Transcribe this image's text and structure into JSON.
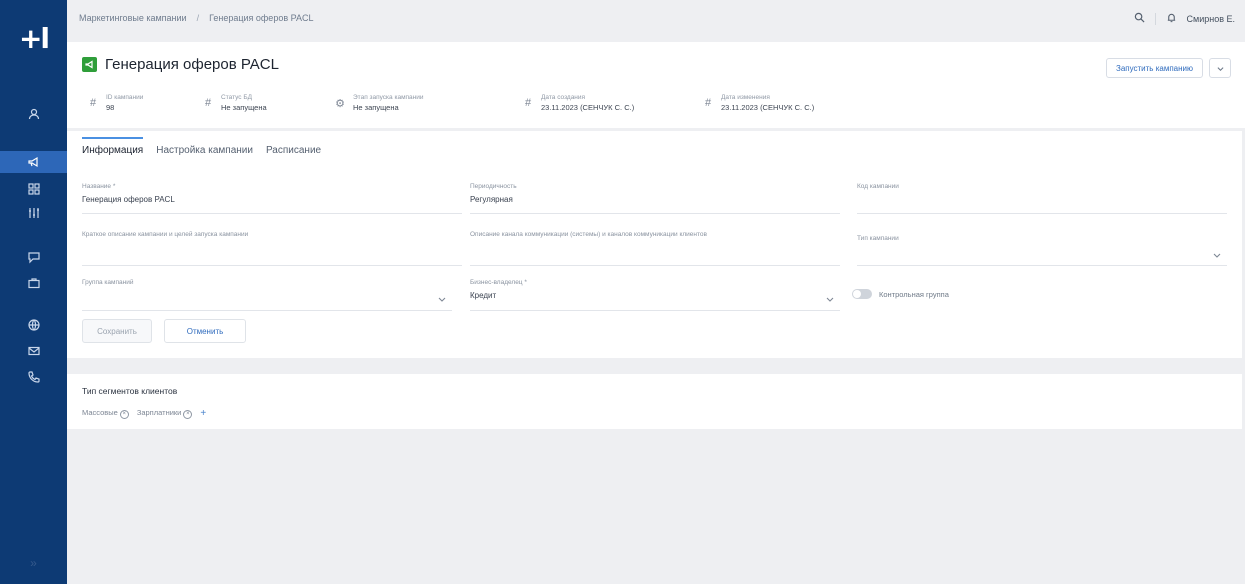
{
  "nav": {
    "logo": "+l",
    "collapse": "»",
    "items": [
      {
        "icon": "users-icon"
      },
      {
        "icon": "megaphone-icon",
        "active": true
      },
      {
        "icon": "grid-icon"
      },
      {
        "icon": "sliders-icon"
      },
      {
        "icon": "chat-icon"
      },
      {
        "icon": "briefcase-icon"
      },
      {
        "icon": "globe-icon"
      },
      {
        "icon": "mail-icon"
      },
      {
        "icon": "phone-icon"
      }
    ]
  },
  "topbar": {
    "breadcrumb": [
      "Маркетинговые кампании",
      "Генерация оферов PACL"
    ],
    "breadcrumb_sep": "/",
    "user": "Смирнов Е."
  },
  "header": {
    "title": "Генерация оферов PACL",
    "run_button": "Запустить кампанию",
    "meta": [
      {
        "label": "ID кампании",
        "value": "98"
      },
      {
        "label": "Статус БД",
        "value": "Не запущена"
      },
      {
        "label": "Этап запуска кампании",
        "value": "Не запущена"
      },
      {
        "label": "Дата создания",
        "value": "23.11.2023 (СЕНЧУК С. С.)"
      },
      {
        "label": "Дата изменения",
        "value": "23.11.2023 (СЕНЧУК С. С.)"
      }
    ]
  },
  "tabs": [
    "Информация",
    "Настройка кампании",
    "Расписание"
  ],
  "form": {
    "name": {
      "label": "Название *",
      "value": "Генерация оферов PACL"
    },
    "periodicity": {
      "label": "Периодичность",
      "value": "Регулярная"
    },
    "code": {
      "label": "Код кампании"
    },
    "description": {
      "label": "Краткое описание кампании и целей запуска кампании"
    },
    "comment": {
      "label": "Описание канала коммуникации (системы) и каналов коммуникации клиентов"
    },
    "channel": {
      "label": "Тип кампании"
    },
    "group": {
      "label": "Группа кампаний"
    },
    "owner": {
      "label": "Бизнес-владелец *",
      "value": "Кредит"
    },
    "toggle": {
      "label": "Контрольная группа"
    },
    "save": "Сохранить",
    "cancel": "Отменить"
  },
  "tags": {
    "title": "Тип сегментов клиентов",
    "items": [
      "Массовые",
      "Зарплатники"
    ],
    "add": "+"
  }
}
